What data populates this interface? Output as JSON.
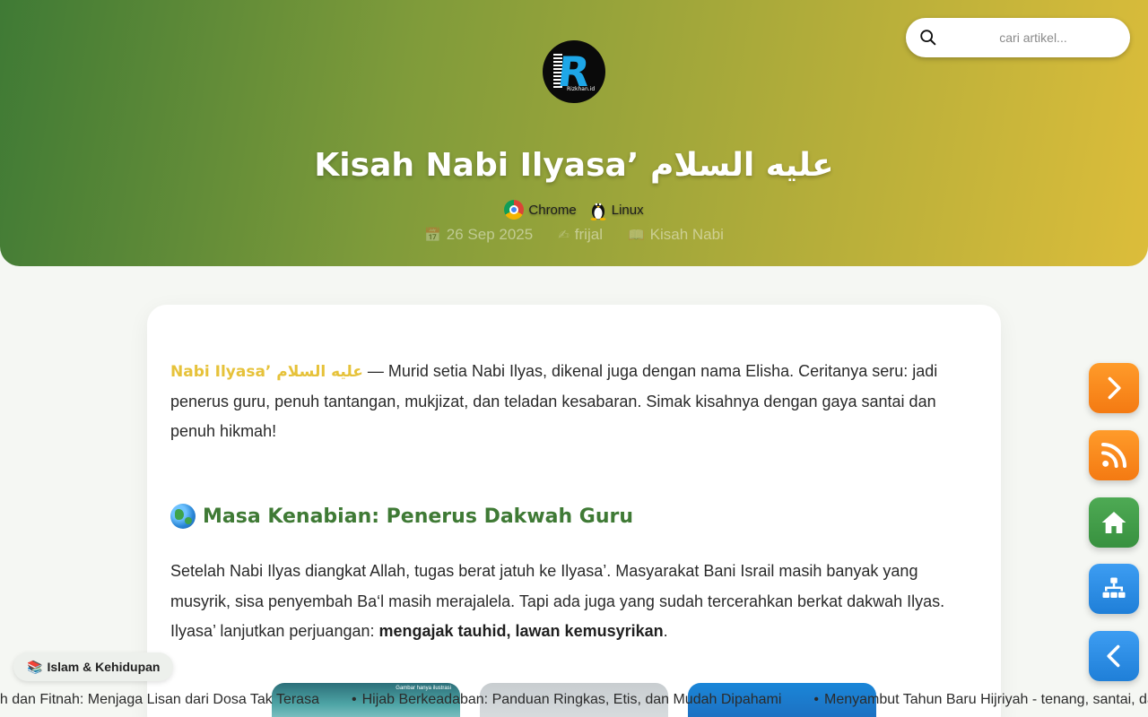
{
  "header": {
    "logo_text": "Rizkhan.id",
    "title": "Kisah Nabi Ilyasa’ عليه السلام",
    "environment": [
      {
        "label": "Chrome",
        "icon": "chrome-icon"
      },
      {
        "label": "Linux",
        "icon": "linux-tux-icon"
      }
    ],
    "meta": {
      "date": "26 Sep 2025",
      "author": "frijal",
      "category": "Kisah Nabi",
      "date_icon": "calendar-icon",
      "author_icon": "writing-hand-icon",
      "category_icon": "book-icon"
    }
  },
  "search": {
    "placeholder": "cari artikel...",
    "value": ""
  },
  "article": {
    "intro_highlight": "Nabi Ilyasa’ عليه السلام",
    "intro_text": " — Murid setia Nabi Ilyas, dikenal juga dengan nama Elisha. Ceritanya seru: jadi penerus guru, penuh tantangan, mukjizat, dan teladan kesabaran. Simak kisahnya dengan gaya santai dan penuh hikmah!",
    "section_heading": "Masa Kenabian: Penerus Dakwah Guru",
    "section_icon": "globe-icon",
    "para_text": "Setelah Nabi Ilyas diangkat Allah, tugas berat jatuh ke Ilyasa’. Masyarakat Bani Israil masih banyak yang musyrik, sisa penyembah Ba‘l masih merajalela. Tapi ada juga yang sudah tercerahkan berkat dakwah Ilyas. Ilyasa’ lanjutkan perjuangan: ",
    "para_bold": "mengajak tauhid, lawan kemusyrikan",
    "para_end": "."
  },
  "category_pill": {
    "label": "Islam & Kehidupan",
    "icon": "books-icon"
  },
  "thumbnails": [
    {
      "caption": "Gambar hanya ilustrasi"
    },
    {
      "caption": ""
    },
    {
      "caption": ""
    }
  ],
  "ticker": [
    "ah dan Fitnah: Menjaga Lisan dari Dosa Tak Terasa",
    "Hijab Berkeadaban: Panduan Ringkas, Etis, dan Mudah Dipahami",
    "Menyambut Tahun Baru Hijriyah - tenang, santai, dan"
  ],
  "side_buttons": [
    {
      "name": "next",
      "icon": "chevron-right-icon",
      "color": "#f47a12"
    },
    {
      "name": "rss",
      "icon": "rss-icon",
      "color": "#f47a12"
    },
    {
      "name": "home",
      "icon": "home-icon",
      "color": "#38913f"
    },
    {
      "name": "sitemap",
      "icon": "sitemap-icon",
      "color": "#1f7fd8"
    },
    {
      "name": "prev",
      "icon": "chevron-left-icon",
      "color": "#1f7fd8"
    }
  ],
  "colors": {
    "header_gradient_start": "#3f7a35",
    "header_gradient_end": "#dcbd3a",
    "heading_green": "#3f7a35",
    "highlight_yellow": "#e6c23a"
  }
}
